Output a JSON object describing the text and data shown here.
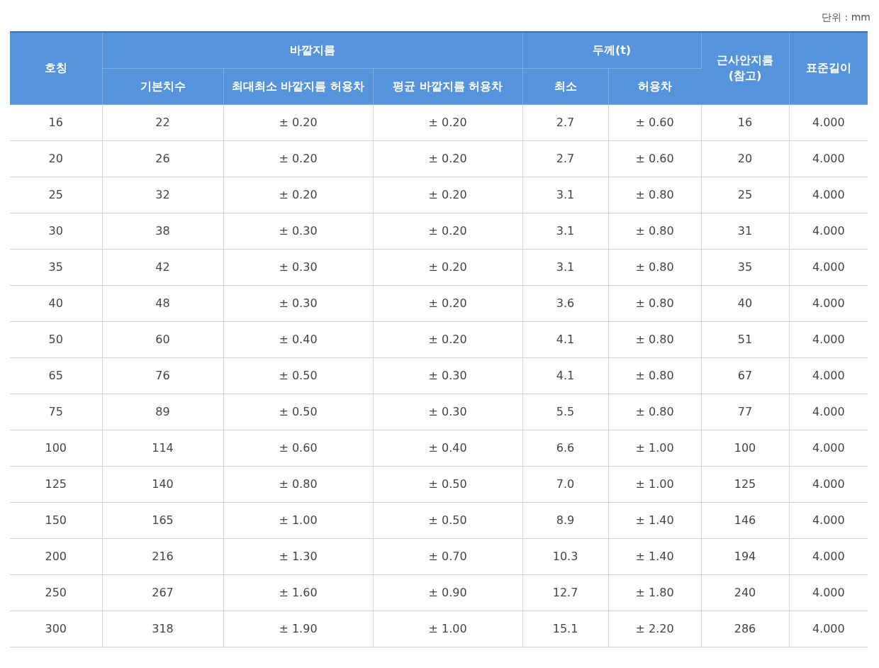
{
  "unit": "단위 : mm",
  "table": {
    "header_rows": [
      [
        {
          "label": "호칭",
          "rowspan": 2
        },
        {
          "label": "바깥지름",
          "colspan": 3
        },
        {
          "label": "두께(t)",
          "colspan": 2
        },
        {
          "label": "근사안지름\n(참고)",
          "rowspan": 2
        },
        {
          "label": "표준길이",
          "rowspan": 2
        }
      ],
      [
        {
          "label": "기본치수"
        },
        {
          "label": "최대최소 바깥지름 허용차"
        },
        {
          "label": "평균 바깥지름 허용차"
        },
        {
          "label": "최소"
        },
        {
          "label": "허용차"
        }
      ]
    ],
    "rows": [
      [
        "16",
        "22",
        "± 0.20",
        "± 0.20",
        "2.7",
        "± 0.60",
        "16",
        "4.000"
      ],
      [
        "20",
        "26",
        "± 0.20",
        "± 0.20",
        "2.7",
        "± 0.60",
        "20",
        "4.000"
      ],
      [
        "25",
        "32",
        "± 0.20",
        "± 0.20",
        "3.1",
        "± 0.80",
        "25",
        "4.000"
      ],
      [
        "30",
        "38",
        "± 0.30",
        "± 0.20",
        "3.1",
        "± 0.80",
        "31",
        "4.000"
      ],
      [
        "35",
        "42",
        "± 0.30",
        "± 0.20",
        "3.1",
        "± 0.80",
        "35",
        "4.000"
      ],
      [
        "40",
        "48",
        "± 0.30",
        "± 0.20",
        "3.6",
        "± 0.80",
        "40",
        "4.000"
      ],
      [
        "50",
        "60",
        "± 0.40",
        "± 0.20",
        "4.1",
        "± 0.80",
        "51",
        "4.000"
      ],
      [
        "65",
        "76",
        "± 0.50",
        "± 0.30",
        "4.1",
        "± 0.80",
        "67",
        "4.000"
      ],
      [
        "75",
        "89",
        "± 0.50",
        "± 0.30",
        "5.5",
        "± 0.80",
        "77",
        "4.000"
      ],
      [
        "100",
        "114",
        "± 0.60",
        "± 0.40",
        "6.6",
        "± 1.00",
        "100",
        "4.000"
      ],
      [
        "125",
        "140",
        "± 0.80",
        "± 0.50",
        "7.0",
        "± 1.00",
        "125",
        "4.000"
      ],
      [
        "150",
        "165",
        "± 1.00",
        "± 0.50",
        "8.9",
        "± 1.40",
        "146",
        "4.000"
      ],
      [
        "200",
        "216",
        "± 1.30",
        "± 0.70",
        "10.3",
        "± 1.40",
        "194",
        "4.000"
      ],
      [
        "250",
        "267",
        "± 1.60",
        "± 0.90",
        "12.7",
        "± 1.80",
        "240",
        "4.000"
      ],
      [
        "300",
        "318",
        "± 1.90",
        "± 1.00",
        "15.1",
        "± 2.20",
        "286",
        "4.000"
      ]
    ]
  }
}
